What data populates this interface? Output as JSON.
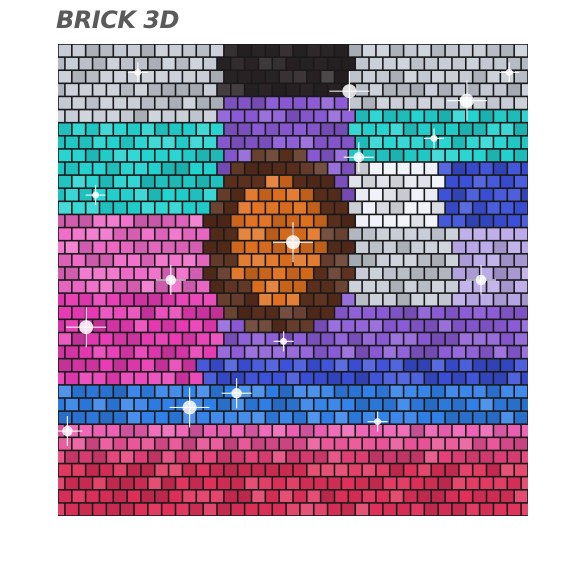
{
  "header": {
    "title": "BRICK 3D"
  },
  "mosaic": {
    "rows": 36,
    "cols": 34,
    "mortar_color": "#1a1a1a",
    "palette": {
      "teal": "#22d3d0",
      "silver": "#c7ccd6",
      "lavender": "#b9a8e8",
      "magenta": "#e83ab4",
      "pink": "#f06ac8",
      "orange": "#e0701f",
      "brown": "#5a2e1c",
      "dark": "#2a2426",
      "blue": "#2f7fe8",
      "navy": "#3b4fd8",
      "crimson": "#e0305a",
      "violet": "#8a5ad6",
      "white": "#eef2f8"
    }
  }
}
